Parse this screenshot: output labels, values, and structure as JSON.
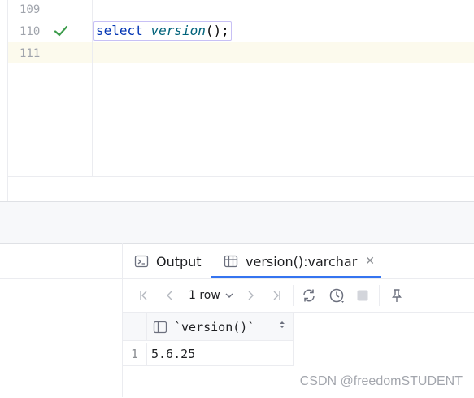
{
  "editor": {
    "line_numbers": [
      "109",
      "110",
      "111"
    ],
    "statement": {
      "keyword": "select",
      "function": "version",
      "rest": "();"
    },
    "status_icon": "check-icon"
  },
  "results": {
    "tabs": [
      {
        "label": "Output",
        "icon": "console-icon"
      },
      {
        "label": "version():varchar",
        "icon": "table-icon",
        "closable": true,
        "active": true
      }
    ],
    "toolbar": {
      "rows_label": "1 row"
    },
    "grid": {
      "columns": [
        "`version()`"
      ],
      "rows": [
        {
          "row_number": "1",
          "cells": [
            "5.6.25"
          ]
        }
      ]
    },
    "colors": {
      "accent": "#3574f0",
      "check": "#3d9c4c",
      "keyword": "#0033b3",
      "function": "#00627a"
    }
  },
  "watermark": "CSDN @freedomSTUDENT"
}
